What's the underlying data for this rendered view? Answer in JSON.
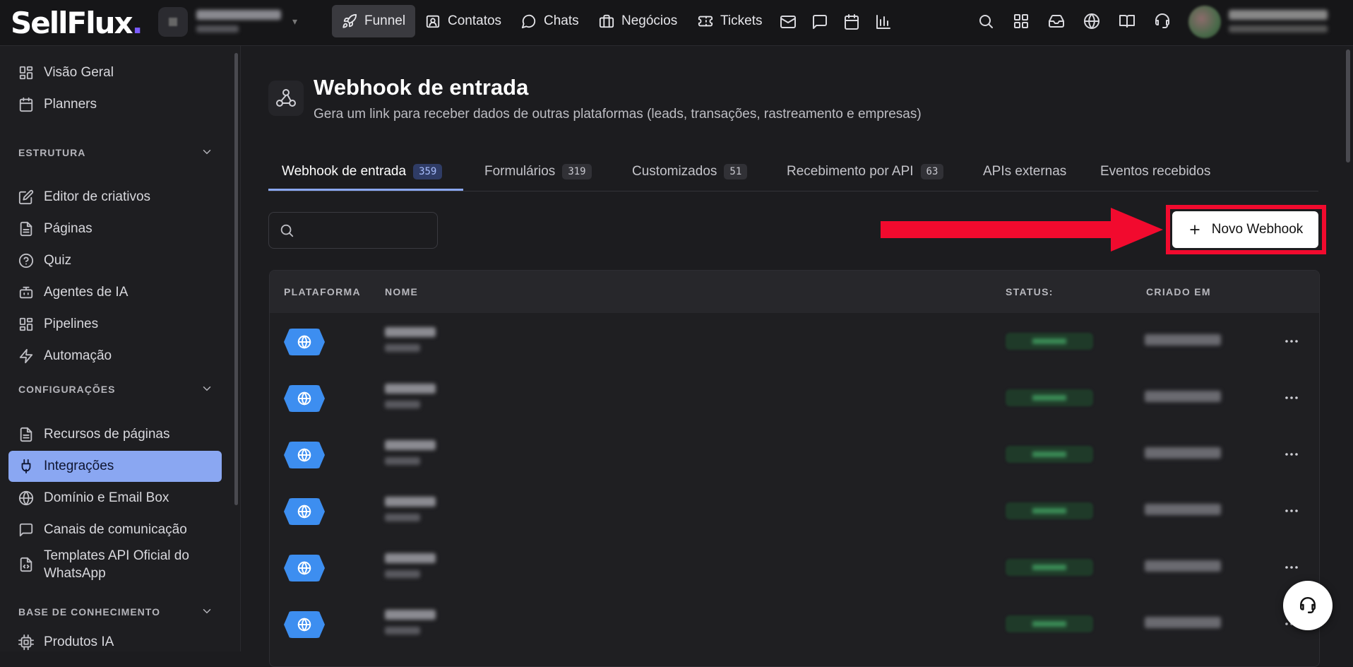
{
  "topbar": {
    "logo_main": "SellFlux",
    "logo_dot": ".",
    "nav": [
      {
        "label": "Funnel",
        "icon": "rocket-icon",
        "active": true
      },
      {
        "label": "Contatos",
        "icon": "contact-card-icon"
      },
      {
        "label": "Chats",
        "icon": "chat-bubble-icon"
      },
      {
        "label": "Negócios",
        "icon": "briefcase-icon"
      },
      {
        "label": "Tickets",
        "icon": "ticket-icon"
      }
    ],
    "extra_icons": [
      "mail-icon",
      "message-square-icon",
      "calendar-icon",
      "bar-chart-icon"
    ],
    "right_icons": [
      "search-icon",
      "apps-grid-icon",
      "inbox-icon",
      "globe-icon",
      "book-icon",
      "headset-icon"
    ]
  },
  "sidebar": {
    "top_items": [
      {
        "label": "Visão Geral",
        "icon": "grid-icon"
      },
      {
        "label": "Planners",
        "icon": "calendar-icon"
      }
    ],
    "sections": [
      {
        "title": "ESTRUTURA",
        "items": [
          {
            "label": "Editor de criativos",
            "icon": "edit-square-icon"
          },
          {
            "label": "Páginas",
            "icon": "file-text-icon"
          },
          {
            "label": "Quiz",
            "icon": "help-circle-icon"
          },
          {
            "label": "Agentes de IA",
            "icon": "bot-icon"
          },
          {
            "label": "Pipelines",
            "icon": "grid-icon"
          },
          {
            "label": "Automação",
            "icon": "lightning-icon"
          }
        ]
      },
      {
        "title": "CONFIGURAÇÕES",
        "items": [
          {
            "label": "Recursos de páginas",
            "icon": "file-text-icon"
          },
          {
            "label": "Integrações",
            "icon": "plug-icon",
            "active": true
          },
          {
            "label": "Domínio e Email Box",
            "icon": "globe-icon"
          },
          {
            "label": "Canais de comunicação",
            "icon": "message-square-icon"
          },
          {
            "label": "Templates API Oficial do WhatsApp",
            "icon": "file-code-icon"
          }
        ]
      },
      {
        "title": "BASE DE CONHECIMENTO",
        "items": [
          {
            "label": "Produtos IA",
            "icon": "chip-icon"
          }
        ]
      }
    ]
  },
  "page": {
    "icon": "webhook-icon",
    "title": "Webhook de entrada",
    "subtitle": "Gera um link para receber dados de outras plataformas (leads, transações, rastreamento e empresas)"
  },
  "tabs": [
    {
      "label": "Webhook de entrada",
      "count": "359",
      "active": true
    },
    {
      "label": "Formulários",
      "count": "319"
    },
    {
      "label": "Customizados",
      "count": "51"
    },
    {
      "label": "Recebimento por API",
      "count": "63"
    },
    {
      "label": "APIs externas",
      "count": ""
    },
    {
      "label": "Eventos recebidos",
      "count": ""
    }
  ],
  "search": {
    "placeholder": "",
    "value": ""
  },
  "new_button": {
    "label": "Novo Webhook",
    "icon": "plus-icon"
  },
  "highlight_color": "#f20a2e",
  "accent_color": "#8aa7f2",
  "table": {
    "columns": [
      "PLATAFORMA",
      "NOME",
      "STATUS:",
      "CRIADO EM"
    ],
    "row_count_visible": 6,
    "row_platform_icon": "globe-webhook-icon",
    "row_action_icon": "more-horizontal-icon"
  },
  "help_button_icon": "headset-icon"
}
